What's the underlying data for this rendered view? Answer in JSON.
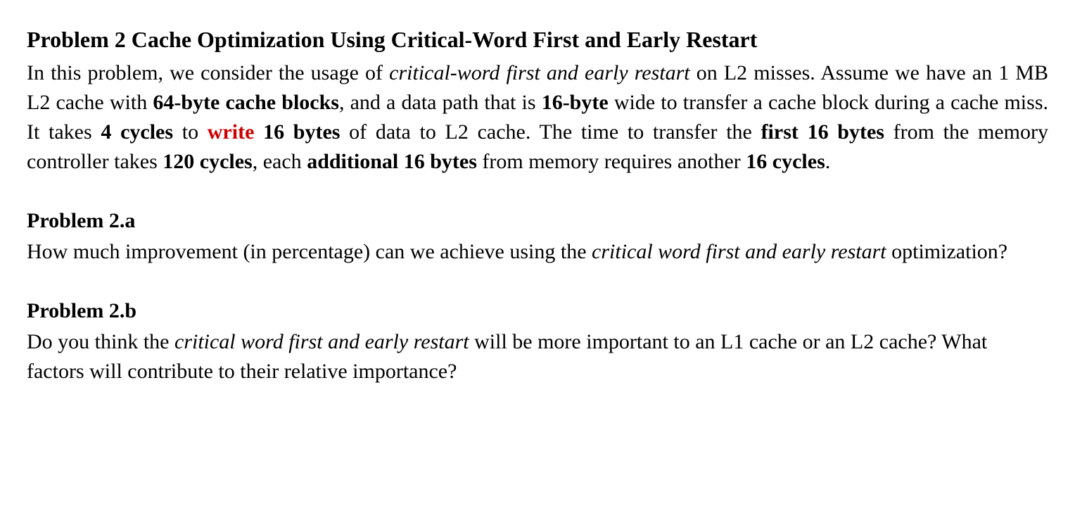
{
  "problem2": {
    "title": "Problem 2 Cache Optimization Using Critical-Word First and Early Restart",
    "intro": {
      "p1a": "In this problem, we consider the usage of ",
      "p1b_italic": "critical-word first and early restart",
      "p1c": " on L2 misses. Assume we have an 1 MB L2 cache with ",
      "p1d_bold": "64-byte cache blocks",
      "p1e": ", and a data path that is ",
      "p1f_bold": "16-byte",
      "p1g": " wide to transfer a cache block during a cache miss. It takes ",
      "p1h_bold": "4 cycles",
      "p1i": " to ",
      "p1j_red_bold": "write",
      "p1k_bold": " 16 bytes",
      "p1l": " of data to L2 cache. The time to transfer the ",
      "p1m_bold": "first 16 bytes",
      "p1n": " from the memory controller takes ",
      "p1o_bold": "120 cycles",
      "p1p": ", each ",
      "p1q_bold": "additional 16 bytes",
      "p1r": " from memory requires another ",
      "p1s_bold": "16 cycles",
      "p1t": "."
    },
    "partA": {
      "heading": "Problem 2.a",
      "q1a": "How much improvement (in percentage) can we achieve using the ",
      "q1b_italic": "critical word first and early restart",
      "q1c": " optimization?"
    },
    "partB": {
      "heading": "Problem 2.b",
      "q1a": "Do you think the ",
      "q1b_italic": "critical word first and early restart",
      "q1c": " will be more important to an L1 cache or an L2 cache? What factors will contribute to their relative importance?"
    }
  }
}
